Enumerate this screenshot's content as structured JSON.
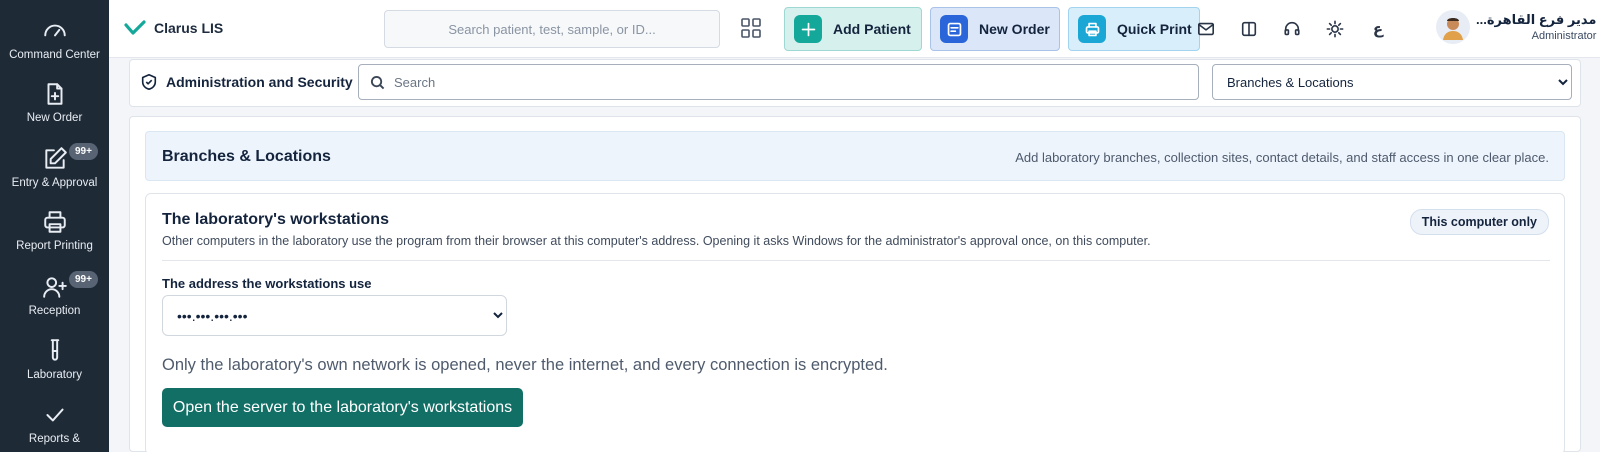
{
  "sidebar": {
    "items": [
      {
        "label": "Command Center",
        "icon": "gauge-icon"
      },
      {
        "label": "New Order",
        "icon": "file-plus-icon"
      },
      {
        "label": "Entry & Approval",
        "icon": "edit-icon",
        "badge": "99+"
      },
      {
        "label": "Report Printing",
        "icon": "printer-icon"
      },
      {
        "label": "Reception",
        "icon": "user-plus-icon",
        "badge": "99+"
      },
      {
        "label": "Laboratory",
        "icon": "test-tube-icon"
      },
      {
        "label": "Reports &",
        "icon": "check-icon"
      }
    ]
  },
  "header": {
    "brand": "Clarus LIS",
    "search_placeholder": "Search patient, test, sample, or ID...",
    "actions": {
      "add_patient": "Add Patient",
      "new_order": "New Order",
      "quick_print": "Quick Print"
    },
    "language": "ع",
    "user": {
      "name": "مدير فرع القاهرة...",
      "role": "Administrator"
    }
  },
  "subbar": {
    "title": "Administration and Security",
    "search_placeholder": "Search",
    "section_selected": "Branches & Locations"
  },
  "section": {
    "title": "Branches & Locations",
    "description": "Add laboratory branches, collection sites, contact details, and staff access in one clear place."
  },
  "workstations": {
    "title": "The laboratory's workstations",
    "description": "Other computers in the laboratory use the program from their browser at this computer's address. Opening it asks Windows for the administrator's approval once, on this computer.",
    "badge": "This computer only",
    "address_label": "The address the workstations use",
    "address_value": "•••.•••.•••.•••",
    "note": "Only the laboratory's own network is opened, never the internet, and every connection is encrypted.",
    "open_button": "Open the server to the laboratory's workstations"
  },
  "colors": {
    "sidebar_bg": "#1f2a37",
    "primary_teal": "#126f66",
    "add_patient_accent": "#14a89a",
    "new_order_accent": "#2a66d9",
    "quick_print_accent": "#1ba7d6"
  }
}
